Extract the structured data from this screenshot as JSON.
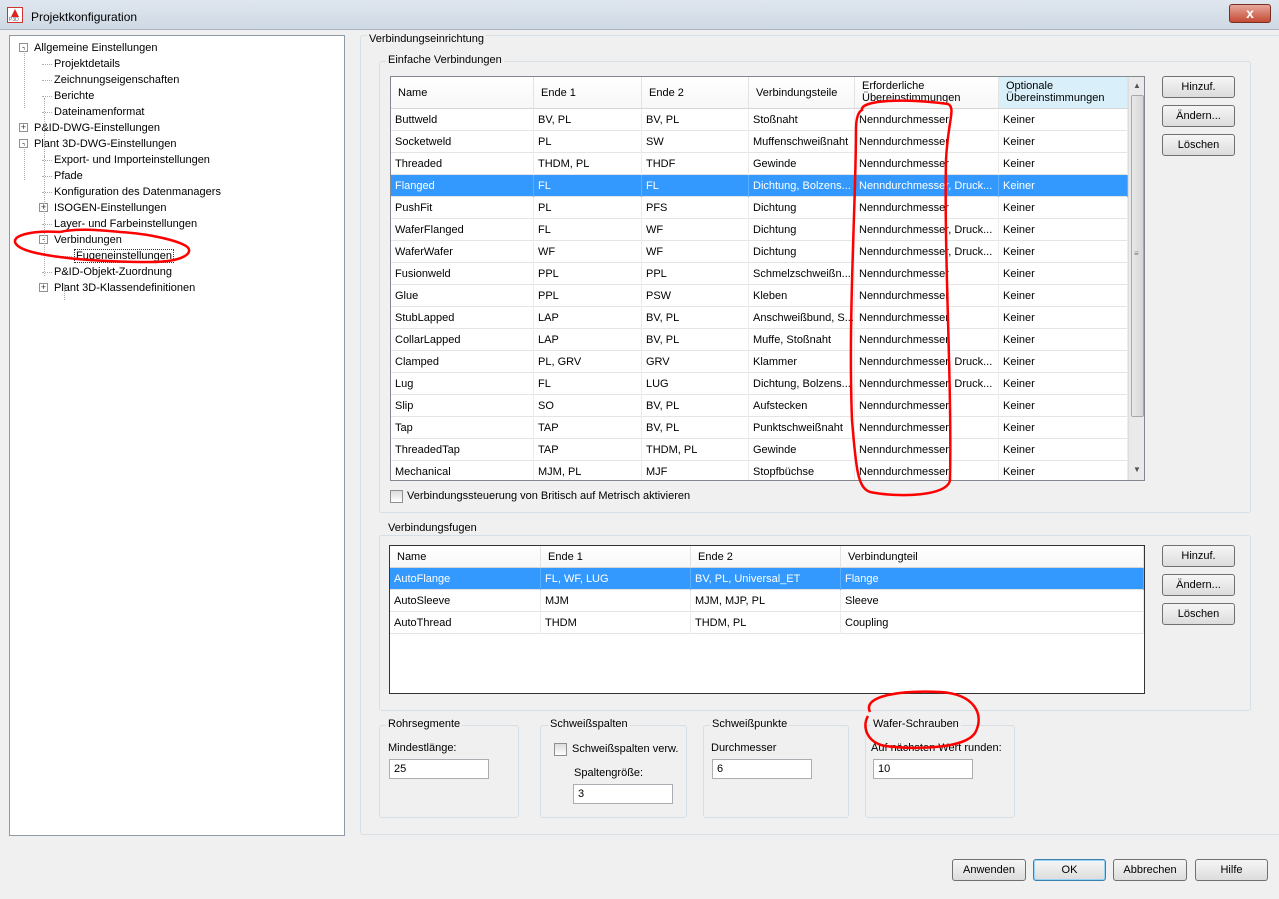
{
  "window": {
    "title": "Projektkonfiguration",
    "close_label": "x"
  },
  "tree": {
    "items": [
      {
        "label": "Allgemeine Einstellungen",
        "level": 0,
        "expander": "-"
      },
      {
        "label": "Projektdetails",
        "level": 1,
        "expander": ""
      },
      {
        "label": "Zeichnungseigenschaften",
        "level": 1,
        "expander": ""
      },
      {
        "label": "Berichte",
        "level": 1,
        "expander": ""
      },
      {
        "label": "Dateinamenformat",
        "level": 1,
        "expander": ""
      },
      {
        "label": "P&ID-DWG-Einstellungen",
        "level": 0,
        "expander": "+"
      },
      {
        "label": "Plant 3D-DWG-Einstellungen",
        "level": 0,
        "expander": "-"
      },
      {
        "label": "Export- und Importeinstellungen",
        "level": 1,
        "expander": ""
      },
      {
        "label": "Pfade",
        "level": 1,
        "expander": ""
      },
      {
        "label": "Konfiguration des Datenmanagers",
        "level": 1,
        "expander": ""
      },
      {
        "label": "ISOGEN-Einstellungen",
        "level": 1,
        "expander": "+"
      },
      {
        "label": "Layer- und Farbeinstellungen",
        "level": 1,
        "expander": ""
      },
      {
        "label": "Verbindungen",
        "level": 1,
        "expander": "-"
      },
      {
        "label": "Fugeneinstellungen",
        "level": 2,
        "expander": "",
        "selected": true
      },
      {
        "label": "P&ID-Objekt-Zuordnung",
        "level": 1,
        "expander": ""
      },
      {
        "label": "Plant 3D-Klassendefinitionen",
        "level": 1,
        "expander": "+"
      }
    ]
  },
  "main": {
    "outer_group": "Verbindungseinrichtung",
    "simple": {
      "group": "Einfache Verbindungen",
      "columns": [
        "Name",
        "Ende 1",
        "Ende 2",
        "Verbindungsteile",
        "Erforderliche Übereinstimmungen",
        "Optionale Übereinstimmungen"
      ],
      "rows": [
        [
          "Buttweld",
          "BV, PL",
          "BV, PL",
          "Stoßnaht",
          "Nenndurchmesser",
          "Keiner"
        ],
        [
          "Socketweld",
          "PL",
          "SW",
          "Muffenschweißnaht",
          "Nenndurchmesser",
          "Keiner"
        ],
        [
          "Threaded",
          "THDM, PL",
          "THDF",
          "Gewinde",
          "Nenndurchmesser",
          "Keiner"
        ],
        [
          "Flanged",
          "FL",
          "FL",
          "Dichtung, Bolzens...",
          "Nenndurchmesser, Druck...",
          "Keiner"
        ],
        [
          "PushFit",
          "PL",
          "PFS",
          "Dichtung",
          "Nenndurchmesser",
          "Keiner"
        ],
        [
          "WaferFlanged",
          "FL",
          "WF",
          "Dichtung",
          "Nenndurchmesser, Druck...",
          "Keiner"
        ],
        [
          "WaferWafer",
          "WF",
          "WF",
          "Dichtung",
          "Nenndurchmesser, Druck...",
          "Keiner"
        ],
        [
          "Fusionweld",
          "PPL",
          "PPL",
          "Schmelzschweißn...",
          "Nenndurchmesser",
          "Keiner"
        ],
        [
          "Glue",
          "PPL",
          "PSW",
          "Kleben",
          "Nenndurchmesser",
          "Keiner"
        ],
        [
          "StubLapped",
          "LAP",
          "BV, PL",
          "Anschweißbund, S...",
          "Nenndurchmesser",
          "Keiner"
        ],
        [
          "CollarLapped",
          "LAP",
          "BV, PL",
          "Muffe, Stoßnaht",
          "Nenndurchmesser",
          "Keiner"
        ],
        [
          "Clamped",
          "PL, GRV",
          "GRV",
          "Klammer",
          "Nenndurchmesser, Druck...",
          "Keiner"
        ],
        [
          "Lug",
          "FL",
          "LUG",
          "Dichtung, Bolzens...",
          "Nenndurchmesser, Druck...",
          "Keiner"
        ],
        [
          "Slip",
          "SO",
          "BV, PL",
          "Aufstecken",
          "Nenndurchmesser",
          "Keiner"
        ],
        [
          "Tap",
          "TAP",
          "BV, PL",
          "Punktschweißnaht",
          "Nenndurchmesser",
          "Keiner"
        ],
        [
          "ThreadedTap",
          "TAP",
          "THDM, PL",
          "Gewinde",
          "Nenndurchmesser",
          "Keiner"
        ],
        [
          "Mechanical",
          "MJM, PL",
          "MJF",
          "Stopfbüchse",
          "Nenndurchmesser",
          "Keiner"
        ]
      ],
      "selected_row": 3,
      "buttons": [
        "Hinzuf.",
        "Ändern...",
        "Löschen"
      ],
      "checkbox_label": "Verbindungssteuerung von Britisch auf Metrisch aktivieren"
    },
    "fugen": {
      "group": "Verbindungsfugen",
      "columns": [
        "Name",
        "Ende 1",
        "Ende 2",
        "Verbindungteil"
      ],
      "rows": [
        [
          "AutoFlange",
          "FL, WF, LUG",
          "BV, PL, Universal_ET",
          "Flange"
        ],
        [
          "AutoSleeve",
          "MJM",
          "MJM, MJP, PL",
          "Sleeve"
        ],
        [
          "AutoThread",
          "THDM",
          "THDM, PL",
          "Coupling"
        ]
      ],
      "selected_row": 0,
      "buttons": [
        "Hinzuf.",
        "Ändern...",
        "Löschen"
      ]
    },
    "rohrsegmente": {
      "group": "Rohrsegmente",
      "label": "Mindestlänge:",
      "value": "25"
    },
    "schweissspalten": {
      "group": "Schweißspalten",
      "checkbox_label": "Schweißspalten verw.",
      "label": "Spaltengröße:",
      "value": "3"
    },
    "schweisspunkte": {
      "group": "Schweißpunkte",
      "label": "Durchmesser",
      "value": "6"
    },
    "wafer": {
      "group": "Wafer-Schrauben",
      "label": "Auf nächsten Wert runden:",
      "value": "10"
    }
  },
  "footer": {
    "buttons": [
      "Anwenden",
      "OK",
      "Abbrechen",
      "Hilfe"
    ]
  },
  "colors": {
    "selection": "#3399ff",
    "annotation": "#ff0000"
  }
}
